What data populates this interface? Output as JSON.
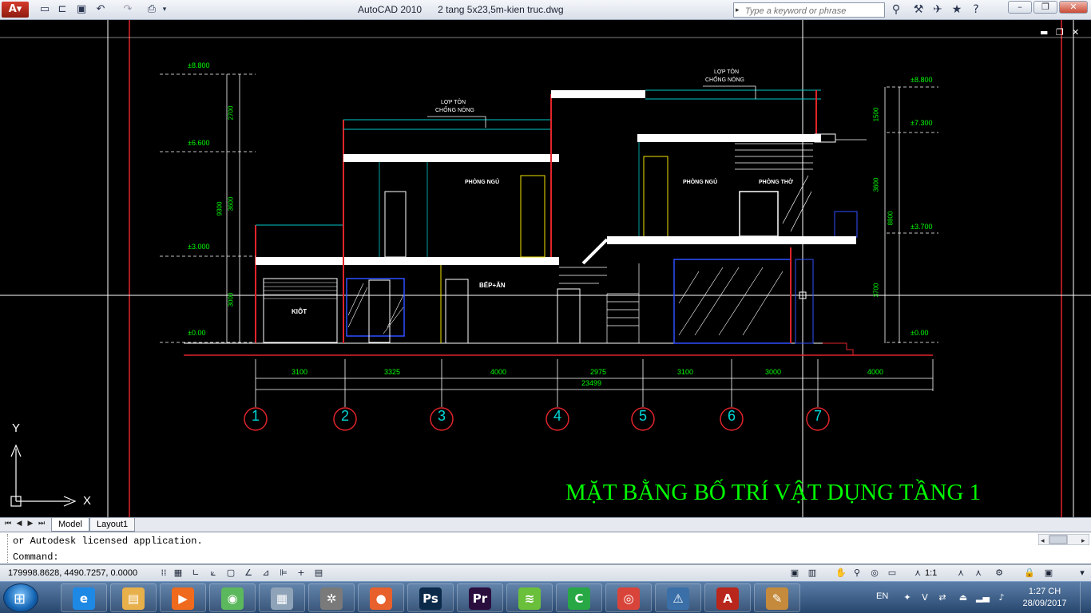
{
  "window": {
    "app_name": "AutoCAD 2010",
    "file_name": "2 tang 5x23,5m-kien truc.dwg",
    "search_placeholder": "Type a keyword or phrase",
    "app_logo_icon": "autocad-logo-icon"
  },
  "drawing": {
    "title": "MẶT BẰNG BỐ TRÍ VẬT DỤNG TẦNG 1",
    "title_color": "#00ff00",
    "rooms": {
      "kiot": "KIÔT",
      "bep_an": "BẾP+ĂN",
      "phong_ngu_left": "PHÒNG NGỦ",
      "phong_ngu_right": "PHÒNG NGỦ",
      "phong_tho": "PHÒNG THỜ"
    },
    "roof_notes": {
      "left_line1": "LỢP TÔN",
      "left_line2": "CHỐNG NÓNG",
      "right_line1": "LỢP TÔN",
      "right_line2": "CHỐNG NÓNG"
    },
    "levels_left": [
      "±8.800",
      "±6.600",
      "±3.000",
      "±0.00"
    ],
    "levels_right": [
      "±8.800",
      "±7.300",
      "±3.700",
      "±0.00"
    ],
    "vertical_dims_left": {
      "d2700": "2700",
      "d3600": "3600",
      "d3000": "3000",
      "total": "9300"
    },
    "vertical_dims_right": {
      "d1500": "1500",
      "d3600": "3600",
      "d3700": "3700",
      "total": "8800"
    },
    "horizontal_dims": [
      "3100",
      "3325",
      "4000",
      "2975",
      "3100",
      "3000",
      "4000"
    ],
    "total_width": "23499",
    "grid_axes": [
      "1",
      "2",
      "3",
      "4",
      "5",
      "6",
      "7"
    ],
    "ucs": {
      "x": "X",
      "y": "Y"
    }
  },
  "tabs": {
    "model": "Model",
    "layout1": "Layout1"
  },
  "command": {
    "history_line": "or Autodesk licensed application.",
    "prompt": "Command:"
  },
  "status": {
    "coordinates": "179998.8628, 4490.7257, 0.0000",
    "annotation_scale": "1:1"
  },
  "taskbar": {
    "language": "EN",
    "time": "1:27 CH",
    "date": "28/09/2017",
    "apps": [
      {
        "name": "internet-explorer",
        "glyph": "e",
        "color": "#1e88e5"
      },
      {
        "name": "file-explorer",
        "glyph": "▤",
        "color": "#e8b04a"
      },
      {
        "name": "media-player",
        "glyph": "▶",
        "color": "#f06a1d"
      },
      {
        "name": "coc-coc",
        "glyph": "◉",
        "color": "#5cb85c"
      },
      {
        "name": "calculator",
        "glyph": "▦",
        "color": "#8fa3b8"
      },
      {
        "name": "settings-gear",
        "glyph": "✲",
        "color": "#7a7a7a"
      },
      {
        "name": "firefox",
        "glyph": "●",
        "color": "#e8602c"
      },
      {
        "name": "photoshop",
        "glyph": "Ps",
        "color": "#0b2a4a"
      },
      {
        "name": "premiere",
        "glyph": "Pr",
        "color": "#2a0e3e"
      },
      {
        "name": "wifi",
        "glyph": "≋",
        "color": "#6abf3b"
      },
      {
        "name": "camtasia",
        "glyph": "C",
        "color": "#28a745"
      },
      {
        "name": "chrome",
        "glyph": "◎",
        "color": "#d9443a"
      },
      {
        "name": "warning-app",
        "glyph": "⚠",
        "color": "#3a6fa8"
      },
      {
        "name": "autocad",
        "glyph": "A",
        "color": "#b9261b"
      },
      {
        "name": "paint",
        "glyph": "✎",
        "color": "#c58a3c"
      }
    ]
  }
}
